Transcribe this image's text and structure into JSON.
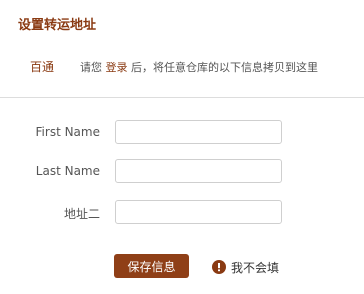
{
  "header": {
    "title": "设置转运地址"
  },
  "carrier": {
    "name": "百通",
    "instruction_before": "请您 ",
    "login_link": "登录",
    "instruction_after": " 后，将任意仓库的以下信息拷贝到这里"
  },
  "form": {
    "fields": [
      {
        "label": "First Name",
        "value": "",
        "placeholder": ""
      },
      {
        "label": "Last Name",
        "value": "",
        "placeholder": ""
      },
      {
        "label": "地址二",
        "value": "",
        "placeholder": ""
      }
    ]
  },
  "actions": {
    "save_label": "保存信息",
    "help_label": "我不会填",
    "help_icon": "alert-circle-icon"
  },
  "colors": {
    "brand": "#8a3a12",
    "button": "#8f3f17",
    "help_icon": "#8a3a12"
  }
}
